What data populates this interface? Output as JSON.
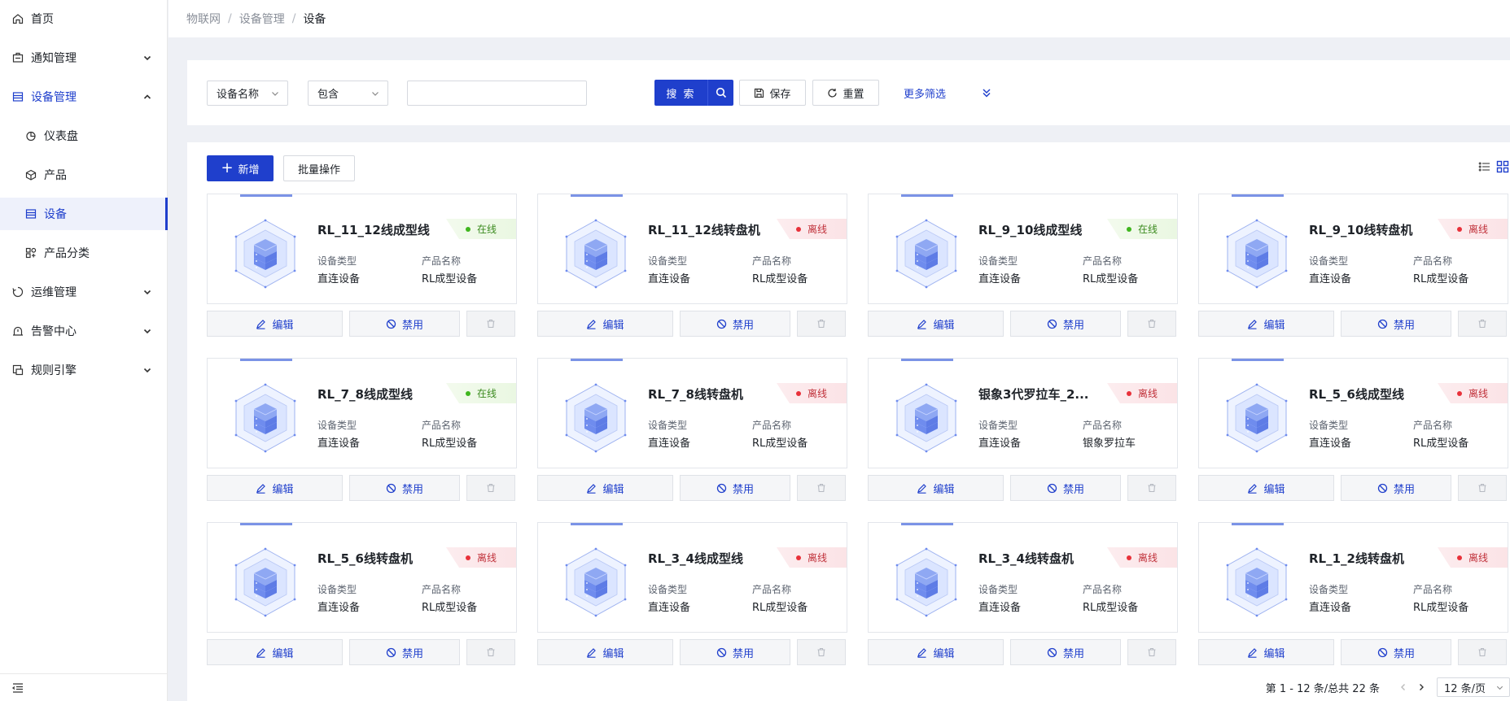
{
  "sidebar": {
    "items": [
      {
        "label": "首页",
        "icon": "home-icon",
        "level": 1
      },
      {
        "label": "通知管理",
        "icon": "notification-icon",
        "level": 1,
        "expandable": true,
        "expanded": false
      },
      {
        "label": "设备管理",
        "icon": "device-manage-icon",
        "level": 1,
        "expandable": true,
        "expanded": true
      },
      {
        "label": "仪表盘",
        "icon": "dashboard-icon",
        "level": 2
      },
      {
        "label": "产品",
        "icon": "product-cube-icon",
        "level": 2
      },
      {
        "label": "设备",
        "icon": "device-list-icon",
        "level": 2,
        "active": true
      },
      {
        "label": "产品分类",
        "icon": "category-icon",
        "level": 2
      },
      {
        "label": "运维管理",
        "icon": "ops-icon",
        "level": 1,
        "expandable": true,
        "expanded": false
      },
      {
        "label": "告警中心",
        "icon": "alarm-icon",
        "level": 1,
        "expandable": true,
        "expanded": false
      },
      {
        "label": "规则引擎",
        "icon": "rule-engine-icon",
        "level": 1,
        "expandable": true,
        "expanded": false
      }
    ],
    "collapse_icon": "menu-collapse-icon"
  },
  "breadcrumb": [
    "物联网",
    "设备管理",
    "设备"
  ],
  "filter": {
    "field_select": "设备名称",
    "operator_select": "包含",
    "keyword_value": "",
    "search_label": "搜 索",
    "save_label": "保存",
    "reset_label": "重置",
    "more_label": "更多筛选"
  },
  "toolbar": {
    "add_label": "新增",
    "batch_label": "批量操作"
  },
  "card_labels": {
    "device_type": "设备类型",
    "product_name": "产品名称",
    "edit": "编辑",
    "disable": "禁用"
  },
  "devices": [
    {
      "name": "RL_11_12线成型线",
      "status": "在线",
      "state": "online",
      "device_type": "直连设备",
      "product_name": "RL成型设备"
    },
    {
      "name": "RL_11_12线转盘机",
      "status": "离线",
      "state": "offline",
      "device_type": "直连设备",
      "product_name": "RL成型设备"
    },
    {
      "name": "RL_9_10线成型线",
      "status": "在线",
      "state": "online",
      "device_type": "直连设备",
      "product_name": "RL成型设备"
    },
    {
      "name": "RL_9_10线转盘机",
      "status": "离线",
      "state": "offline",
      "device_type": "直连设备",
      "product_name": "RL成型设备"
    },
    {
      "name": "RL_7_8线成型线",
      "status": "在线",
      "state": "online",
      "device_type": "直连设备",
      "product_name": "RL成型设备"
    },
    {
      "name": "RL_7_8线转盘机",
      "status": "离线",
      "state": "offline",
      "device_type": "直连设备",
      "product_name": "RL成型设备"
    },
    {
      "name": "银象3代罗拉车_2...",
      "status": "离线",
      "state": "offline",
      "device_type": "直连设备",
      "product_name": "银象罗拉车"
    },
    {
      "name": "RL_5_6线成型线",
      "status": "离线",
      "state": "offline",
      "device_type": "直连设备",
      "product_name": "RL成型设备"
    },
    {
      "name": "RL_5_6线转盘机",
      "status": "离线",
      "state": "offline",
      "device_type": "直连设备",
      "product_name": "RL成型设备"
    },
    {
      "name": "RL_3_4线成型线",
      "status": "离线",
      "state": "offline",
      "device_type": "直连设备",
      "product_name": "RL成型设备"
    },
    {
      "name": "RL_3_4线转盘机",
      "status": "离线",
      "state": "offline",
      "device_type": "直连设备",
      "product_name": "RL成型设备"
    },
    {
      "name": "RL_1_2线转盘机",
      "status": "离线",
      "state": "offline",
      "device_type": "直连设备",
      "product_name": "RL成型设备"
    }
  ],
  "pagination": {
    "summary": "第 1 - 12 条/总共 22 条",
    "page_size": "12 条/页"
  },
  "colors": {
    "primary": "#1f3fcc",
    "online": "#3fb61e",
    "offline": "#e8313a"
  }
}
